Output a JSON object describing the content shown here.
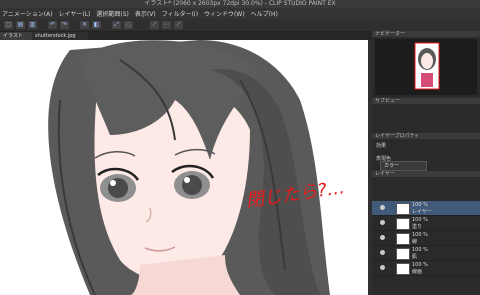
{
  "window": {
    "title": "イラスト* (2060 x 2603px 72dpi 30.0%) - CLIP STUDIO PAINT EX"
  },
  "menubar": {
    "items": [
      "アニメーション(A)",
      "レイヤー(L)",
      "選択範囲(S)",
      "表示(V)",
      "フィルター(I)",
      "ウィンドウ(W)",
      "ヘルプ(H)"
    ]
  },
  "tabs": [
    {
      "label": "イラスト"
    },
    {
      "label": "shutterstock.jpg"
    }
  ],
  "canvas": {
    "handwritten_text": "閉じたら?…"
  },
  "panels": {
    "navigator": {
      "title": "ナビゲーター"
    },
    "sub_view": {
      "title": "サブビュー"
    },
    "property": {
      "title": "レイヤープロパティ",
      "effect_label": "効果",
      "expression_color_label": "表現色",
      "expression_color_value": "カラー"
    },
    "layers": {
      "title": "レイヤー",
      "items": [
        {
          "pct": "100 %",
          "name": "レイヤー"
        },
        {
          "pct": "100 %",
          "name": "塗り"
        },
        {
          "pct": "100 %",
          "name": "線"
        },
        {
          "pct": "100 %",
          "name": "肌"
        },
        {
          "pct": "100 %",
          "name": "線画"
        }
      ]
    }
  },
  "colors": {
    "accent": "#415a7a",
    "annotation": "#e51b1b",
    "hair": "#5a5a5a"
  }
}
